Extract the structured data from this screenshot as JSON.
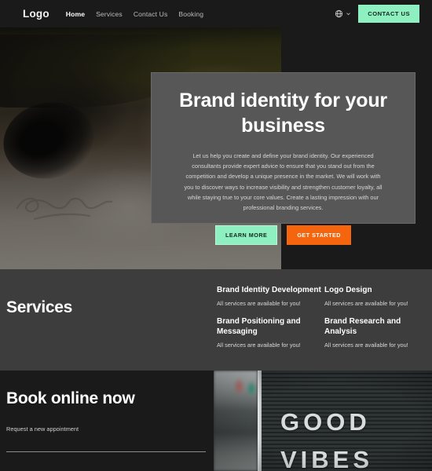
{
  "nav": {
    "logo": "Logo",
    "links": [
      {
        "label": "Home",
        "active": true
      },
      {
        "label": "Services",
        "active": false
      },
      {
        "label": "Contact Us",
        "active": false
      },
      {
        "label": "Booking",
        "active": false
      }
    ],
    "language_icon": "globe-icon",
    "chevron_icon": "chevron-down-icon",
    "cta_label": "CONTACT US",
    "cta_color": "#8ef0c0"
  },
  "hero": {
    "title": "Brand identity for your business",
    "body": "Let us help you create and define your brand identity. Our experienced consultants provide expert advice to ensure that you stand out from the competition and develop a unique presence in the market. We will work with you to discover ways to increase visibility and strengthen customer loyalty, all while staying true to your core values. Create a lasting impression with our professional branding services.",
    "primary_button": "LEARN MORE",
    "secondary_button": "GET STARTED",
    "primary_color": "#8ef0c0",
    "secondary_color": "#f4650d",
    "card_background": "#575757"
  },
  "services": {
    "title": "Services",
    "background": "#3d3d3d",
    "columns": [
      [
        {
          "name": "Brand Identity Development",
          "desc": "All services are available for you!"
        },
        {
          "name": "Brand Positioning and Messaging",
          "desc": "All services are available for you!"
        }
      ],
      [
        {
          "name": "Logo Design",
          "desc": "All services are available for you!"
        },
        {
          "name": "Brand Research and Analysis",
          "desc": "All services are available for you!"
        }
      ]
    ]
  },
  "booking": {
    "title": "Book online now",
    "subtitle": "Request a new appointment",
    "photo_text_line1": "GOOD",
    "photo_text_line2": "VIBES"
  }
}
